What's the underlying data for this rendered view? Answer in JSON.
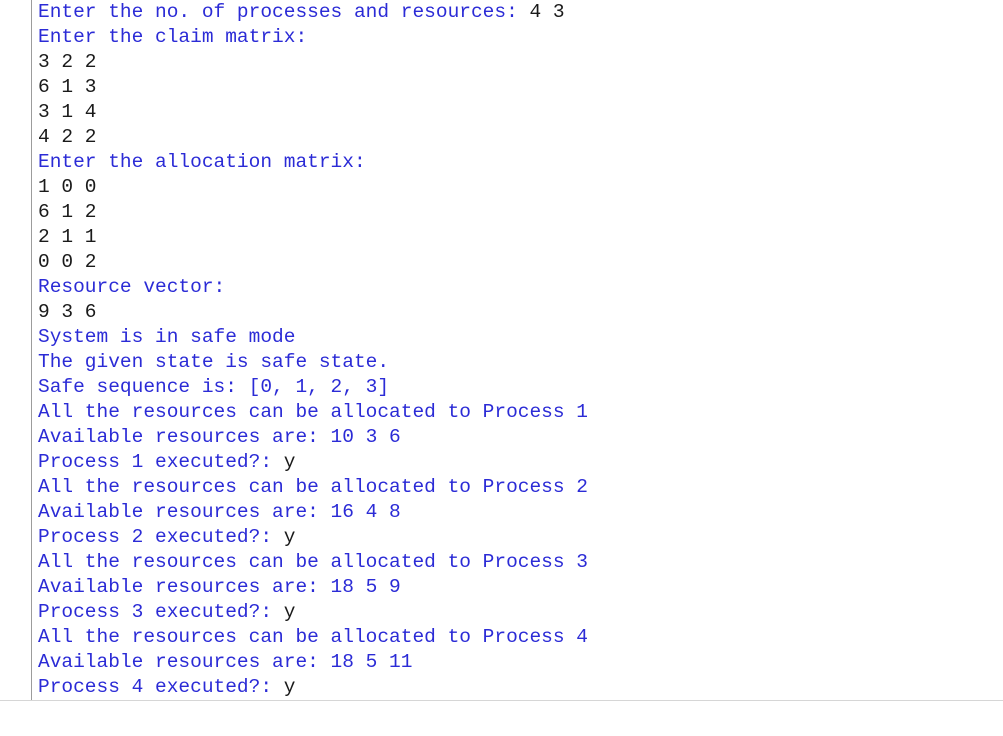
{
  "colors": {
    "prompt": "#2b2bd6",
    "input": "#1a1a1a",
    "gutter": "#9c9c9c"
  },
  "console": {
    "lines": [
      {
        "text": "Enter the no. of processes and resources: ",
        "input": "4 3"
      },
      {
        "text": "Enter the claim matrix:",
        "input": ""
      },
      {
        "text": "",
        "input": "3 2 2"
      },
      {
        "text": "",
        "input": "6 1 3"
      },
      {
        "text": "",
        "input": "3 1 4"
      },
      {
        "text": "",
        "input": "4 2 2"
      },
      {
        "text": "Enter the allocation matrix:",
        "input": ""
      },
      {
        "text": "",
        "input": "1 0 0"
      },
      {
        "text": "",
        "input": "6 1 2"
      },
      {
        "text": "",
        "input": "2 1 1"
      },
      {
        "text": "",
        "input": "0 0 2"
      },
      {
        "text": "Resource vector:",
        "input": ""
      },
      {
        "text": "",
        "input": "9 3 6"
      },
      {
        "text": "System is in safe mode",
        "input": ""
      },
      {
        "text": "The given state is safe state.",
        "input": ""
      },
      {
        "text": "Safe sequence is: [0, 1, 2, 3]",
        "input": ""
      },
      {
        "text": "All the resources can be allocated to Process 1",
        "input": ""
      },
      {
        "text": "Available resources are: 10 3 6",
        "input": ""
      },
      {
        "text": "Process 1 executed?: ",
        "input": "y"
      },
      {
        "text": "All the resources can be allocated to Process 2",
        "input": ""
      },
      {
        "text": "Available resources are: 16 4 8",
        "input": ""
      },
      {
        "text": "Process 2 executed?: ",
        "input": "y"
      },
      {
        "text": "All the resources can be allocated to Process 3",
        "input": ""
      },
      {
        "text": "Available resources are: 18 5 9",
        "input": ""
      },
      {
        "text": "Process 3 executed?: ",
        "input": "y"
      },
      {
        "text": "All the resources can be allocated to Process 4",
        "input": ""
      },
      {
        "text": "Available resources are: 18 5 11",
        "input": ""
      },
      {
        "text": "Process 4 executed?: ",
        "input": "y"
      }
    ]
  }
}
